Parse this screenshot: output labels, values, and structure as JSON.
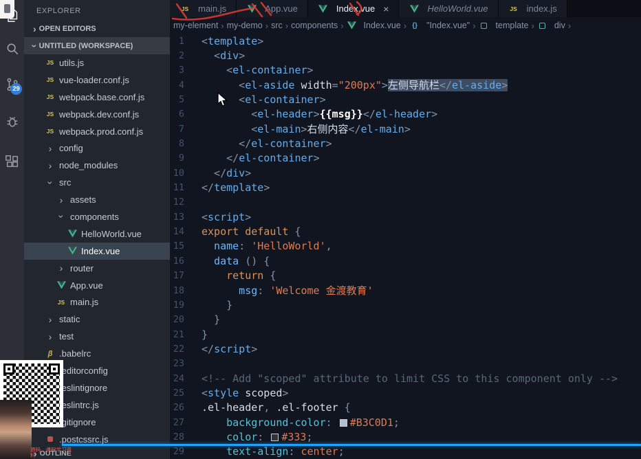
{
  "activity_bar": {
    "badge": "29",
    "icons": [
      "explorer",
      "search",
      "source-control",
      "debug",
      "extensions"
    ]
  },
  "sidebar": {
    "title": "EXPLORER",
    "open_editors_label": "OPEN EDITORS",
    "workspace_label": "UNTITLED (WORKSPACE)",
    "outline_label": "OUTLINE",
    "tree": [
      {
        "label": "utils.js",
        "icon": "js",
        "level": 1
      },
      {
        "label": "vue-loader.conf.js",
        "icon": "js",
        "level": 1
      },
      {
        "label": "webpack.base.conf.js",
        "icon": "js",
        "level": 1
      },
      {
        "label": "webpack.dev.conf.js",
        "icon": "js",
        "level": 1
      },
      {
        "label": "webpack.prod.conf.js",
        "icon": "js",
        "level": 1
      },
      {
        "label": "config",
        "icon": "folder-collapsed",
        "level": 1
      },
      {
        "label": "node_modules",
        "icon": "folder-collapsed",
        "level": 1
      },
      {
        "label": "src",
        "icon": "folder-expanded",
        "level": 1
      },
      {
        "label": "assets",
        "icon": "folder-collapsed",
        "level": 2
      },
      {
        "label": "components",
        "icon": "folder-expanded",
        "level": 2
      },
      {
        "label": "HelloWorld.vue",
        "icon": "vue",
        "level": 3
      },
      {
        "label": "Index.vue",
        "icon": "vue",
        "level": 3,
        "selected": true
      },
      {
        "label": "router",
        "icon": "folder-collapsed",
        "level": 2
      },
      {
        "label": "App.vue",
        "icon": "vue",
        "level": 2
      },
      {
        "label": "main.js",
        "icon": "js",
        "level": 2
      },
      {
        "label": "static",
        "icon": "folder-collapsed",
        "level": 1
      },
      {
        "label": "test",
        "icon": "folder-collapsed",
        "level": 1
      },
      {
        "label": ".babelrc",
        "icon": "babel",
        "level": 1
      },
      {
        "label": ".editorconfig",
        "icon": "editorconfig",
        "level": 1
      },
      {
        "label": ".eslintignore",
        "icon": "eslint",
        "level": 1
      },
      {
        "label": ".eslintrc.js",
        "icon": "eslint",
        "level": 1
      },
      {
        "label": ".gitignore",
        "icon": "git",
        "level": 1
      },
      {
        "label": ".postcssrc.js",
        "icon": "postcss",
        "level": 1
      }
    ]
  },
  "editor_tabs": [
    {
      "label": "main.js",
      "icon": "js"
    },
    {
      "label": "App.vue",
      "icon": "vue"
    },
    {
      "label": "Index.vue",
      "icon": "vue",
      "active": true,
      "close": "×"
    },
    {
      "label": "HelloWorld.vue",
      "icon": "vue",
      "italic": true
    },
    {
      "label": "index.js",
      "icon": "js"
    }
  ],
  "breadcrumbs": {
    "items": [
      {
        "label": "my-element"
      },
      {
        "label": "my-demo"
      },
      {
        "label": "src"
      },
      {
        "label": "components"
      },
      {
        "label": "Index.vue",
        "icon": "vue"
      },
      {
        "label": "\"Index.vue\"",
        "icon": "braces"
      },
      {
        "label": "template",
        "icon": "symbol"
      },
      {
        "label": "div",
        "icon": "symbol"
      }
    ],
    "separator": "›"
  },
  "editor": {
    "lines": [
      {
        "n": "1",
        "t": [
          [
            "pt",
            "<"
          ],
          [
            "tag",
            "template"
          ],
          [
            "pt",
            ">"
          ]
        ]
      },
      {
        "n": "2",
        "t": [
          [
            "pt",
            "  <"
          ],
          [
            "tag",
            "div"
          ],
          [
            "pt",
            ">"
          ]
        ]
      },
      {
        "n": "3",
        "t": [
          [
            "pt",
            "    <"
          ],
          [
            "tag",
            "el-container"
          ],
          [
            "pt",
            ">"
          ]
        ]
      },
      {
        "n": "4",
        "t": [
          [
            "pt",
            "      <"
          ],
          [
            "tag",
            "el-aside"
          ],
          [
            "attr",
            " width"
          ],
          [
            "pt",
            "="
          ],
          [
            "str",
            "\"200px\""
          ],
          [
            "pt",
            ">"
          ],
          [
            "txt sel",
            "左侧导航栏"
          ],
          [
            "pt sel",
            "</"
          ],
          [
            "tag sel",
            "el-aside"
          ],
          [
            "pt sel",
            ">"
          ]
        ]
      },
      {
        "n": "5",
        "t": [
          [
            "pt",
            "      <"
          ],
          [
            "tag",
            "el-container"
          ],
          [
            "pt",
            ">"
          ]
        ]
      },
      {
        "n": "6",
        "t": [
          [
            "pt",
            "        <"
          ],
          [
            "tag",
            "el-header"
          ],
          [
            "pt",
            ">"
          ],
          [
            "mus",
            "{{msg}}"
          ],
          [
            "pt",
            "</"
          ],
          [
            "tag",
            "el-header"
          ],
          [
            "pt",
            ">"
          ]
        ]
      },
      {
        "n": "7",
        "t": [
          [
            "pt",
            "        <"
          ],
          [
            "tag",
            "el-main"
          ],
          [
            "pt",
            ">"
          ],
          [
            "txt",
            "右侧内容"
          ],
          [
            "pt",
            "</"
          ],
          [
            "tag",
            "el-main"
          ],
          [
            "pt",
            ">"
          ]
        ]
      },
      {
        "n": "8",
        "t": [
          [
            "pt",
            "      </"
          ],
          [
            "tag",
            "el-container"
          ],
          [
            "pt",
            ">"
          ]
        ]
      },
      {
        "n": "9",
        "t": [
          [
            "pt",
            "    </"
          ],
          [
            "tag",
            "el-container"
          ],
          [
            "pt",
            ">"
          ]
        ]
      },
      {
        "n": "10",
        "t": [
          [
            "pt",
            "  </"
          ],
          [
            "tag",
            "div"
          ],
          [
            "pt",
            ">"
          ]
        ]
      },
      {
        "n": "11",
        "t": [
          [
            "pt",
            "</"
          ],
          [
            "tag",
            "template"
          ],
          [
            "pt",
            ">"
          ]
        ]
      },
      {
        "n": "12",
        "t": []
      },
      {
        "n": "13",
        "t": [
          [
            "pt",
            "<"
          ],
          [
            "tag",
            "script"
          ],
          [
            "pt",
            ">"
          ]
        ]
      },
      {
        "n": "14",
        "t": [
          [
            "kw",
            "export default"
          ],
          [
            "pt",
            " {"
          ]
        ]
      },
      {
        "n": "15",
        "t": [
          [
            "prop",
            "  name"
          ],
          [
            "pt",
            ": "
          ],
          [
            "str",
            "'HelloWorld'"
          ],
          [
            "pt",
            ","
          ]
        ]
      },
      {
        "n": "16",
        "t": [
          [
            "prop",
            "  data"
          ],
          [
            "pt",
            " () {"
          ]
        ]
      },
      {
        "n": "17",
        "t": [
          [
            "kw",
            "    return"
          ],
          [
            "pt",
            " {"
          ]
        ]
      },
      {
        "n": "18",
        "t": [
          [
            "prop",
            "      msg"
          ],
          [
            "pt",
            ": "
          ],
          [
            "str",
            "'Welcome 金渡教育'"
          ]
        ]
      },
      {
        "n": "19",
        "t": [
          [
            "pt",
            "    }"
          ]
        ]
      },
      {
        "n": "20",
        "t": [
          [
            "pt",
            "  }"
          ]
        ]
      },
      {
        "n": "21",
        "t": [
          [
            "pt",
            "}"
          ]
        ]
      },
      {
        "n": "22",
        "t": [
          [
            "pt",
            "</"
          ],
          [
            "tag",
            "script"
          ],
          [
            "pt",
            ">"
          ]
        ]
      },
      {
        "n": "23",
        "t": []
      },
      {
        "n": "24",
        "t": [
          [
            "com",
            "<!-- Add \"scoped\" attribute to limit CSS to this component only -->"
          ]
        ]
      },
      {
        "n": "25",
        "t": [
          [
            "pt",
            "<"
          ],
          [
            "tag",
            "style"
          ],
          [
            "attr",
            " scoped"
          ],
          [
            "pt",
            ">"
          ]
        ]
      },
      {
        "n": "26",
        "t": [
          [
            "selr",
            ".el-header"
          ],
          [
            "pt",
            ", "
          ],
          [
            "selr",
            ".el-footer"
          ],
          [
            "pt",
            " {"
          ]
        ]
      },
      {
        "n": "27",
        "t": [
          [
            "cssprop",
            "    background-color"
          ],
          [
            "pt",
            ": "
          ],
          [
            "swatch",
            "#B3C0D1"
          ],
          [
            "val",
            "#B3C0D1"
          ],
          [
            "pt",
            ";"
          ]
        ]
      },
      {
        "n": "28",
        "t": [
          [
            "cssprop",
            "    color"
          ],
          [
            "pt",
            ": "
          ],
          [
            "swatch",
            "#333"
          ],
          [
            "val",
            "#333"
          ],
          [
            "pt",
            ";"
          ]
        ]
      },
      {
        "n": "29",
        "t": [
          [
            "cssprop",
            "    text-align"
          ],
          [
            "pt",
            ": "
          ],
          [
            "val",
            "center"
          ],
          [
            "pt",
            ";"
          ]
        ]
      }
    ]
  },
  "overlay": {
    "caption": "源码、课程学习资料",
    "progress_color": "#1da4ff"
  }
}
